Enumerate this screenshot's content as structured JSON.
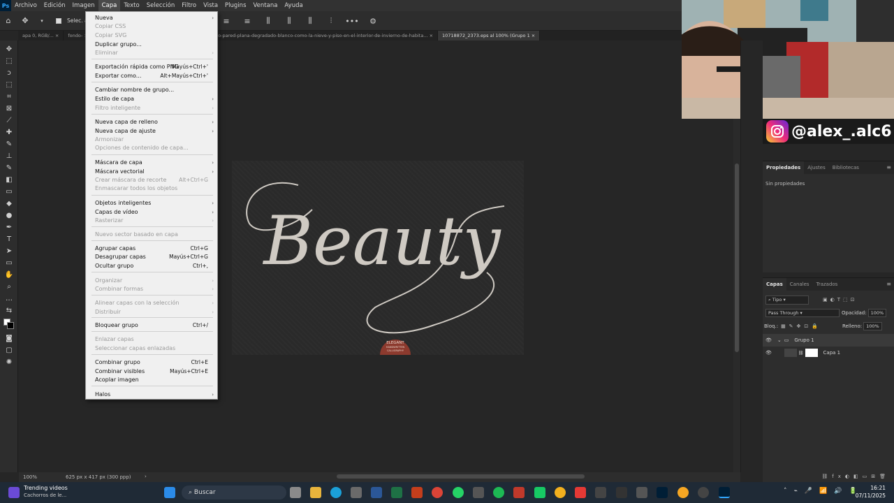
{
  "menubar": {
    "items": [
      "Archivo",
      "Edición",
      "Imagen",
      "Capa",
      "Texto",
      "Selección",
      "Filtro",
      "Vista",
      "Plugins",
      "Ventana",
      "Ayuda"
    ],
    "active_index": 3,
    "app_badge": "Ps"
  },
  "options_bar": {
    "autoselect_label": "Selec. autom"
  },
  "tabs": [
    {
      "label": "apa 0, RGB/...",
      "active": false
    },
    {
      "label": "fondo-",
      "active": false
    },
    {
      "label": "-de-fondo-de-belleza-azul-claro-oscuro-y-claro-gris-frio-pared-plana-degradado-blanco-como-la-nieve-y-piso-en-el-interior-de-invierno-de-habita...",
      "active": false
    },
    {
      "label": "10718872_2373.eps al 100% (Grupo 1",
      "active": true
    }
  ],
  "capa_menu": {
    "items": [
      {
        "label": "Nueva",
        "shortcut": "",
        "submenu": true,
        "disabled": false
      },
      {
        "label": "Copiar CSS",
        "shortcut": "",
        "submenu": false,
        "disabled": true
      },
      {
        "label": "Copiar SVG",
        "shortcut": "",
        "submenu": false,
        "disabled": true
      },
      {
        "label": "Duplicar grupo...",
        "shortcut": "",
        "submenu": false,
        "disabled": false
      },
      {
        "label": "Eliminar",
        "shortcut": "",
        "submenu": true,
        "disabled": true
      },
      {
        "label": "Exportación rápida como PNG",
        "shortcut": "Mayús+Ctrl+'",
        "submenu": false,
        "disabled": false
      },
      {
        "label": "Exportar como...",
        "shortcut": "Alt+Mayús+Ctrl+'",
        "submenu": false,
        "disabled": false
      },
      {
        "label": "Cambiar nombre de grupo...",
        "shortcut": "",
        "submenu": false,
        "disabled": false
      },
      {
        "label": "Estilo de capa",
        "shortcut": "",
        "submenu": true,
        "disabled": false
      },
      {
        "label": "Filtro inteligente",
        "shortcut": "",
        "submenu": true,
        "disabled": true
      },
      {
        "label": "Nueva capa de relleno",
        "shortcut": "",
        "submenu": true,
        "disabled": false
      },
      {
        "label": "Nueva capa de ajuste",
        "shortcut": "",
        "submenu": true,
        "disabled": false
      },
      {
        "label": "Armonizar",
        "shortcut": "",
        "submenu": false,
        "disabled": true
      },
      {
        "label": "Opciones de contenido de capa...",
        "shortcut": "",
        "submenu": false,
        "disabled": true
      },
      {
        "label": "Máscara de capa",
        "shortcut": "",
        "submenu": true,
        "disabled": false
      },
      {
        "label": "Máscara vectorial",
        "shortcut": "",
        "submenu": true,
        "disabled": false
      },
      {
        "label": "Crear máscara de recorte",
        "shortcut": "Alt+Ctrl+G",
        "submenu": false,
        "disabled": true
      },
      {
        "label": "Enmascarar todos los objetos",
        "shortcut": "",
        "submenu": false,
        "disabled": true
      },
      {
        "label": "Objetos inteligentes",
        "shortcut": "",
        "submenu": true,
        "disabled": false
      },
      {
        "label": "Capas de vídeo",
        "shortcut": "",
        "submenu": true,
        "disabled": false
      },
      {
        "label": "Rasterizar",
        "shortcut": "",
        "submenu": true,
        "disabled": true
      },
      {
        "label": "Nuevo sector basado en capa",
        "shortcut": "",
        "submenu": false,
        "disabled": true
      },
      {
        "label": "Agrupar capas",
        "shortcut": "Ctrl+G",
        "submenu": false,
        "disabled": false
      },
      {
        "label": "Desagrupar capas",
        "shortcut": "Mayús+Ctrl+G",
        "submenu": false,
        "disabled": false
      },
      {
        "label": "Ocultar grupo",
        "shortcut": "Ctrl+,",
        "submenu": false,
        "disabled": false
      },
      {
        "label": "Organizar",
        "shortcut": "",
        "submenu": true,
        "disabled": true
      },
      {
        "label": "Combinar formas",
        "shortcut": "",
        "submenu": true,
        "disabled": true
      },
      {
        "label": "Alinear capas con la selección",
        "shortcut": "",
        "submenu": true,
        "disabled": true
      },
      {
        "label": "Distribuir",
        "shortcut": "",
        "submenu": true,
        "disabled": true
      },
      {
        "label": "Bloquear grupo",
        "shortcut": "Ctrl+/",
        "submenu": false,
        "disabled": false
      },
      {
        "label": "Enlazar capas",
        "shortcut": "",
        "submenu": false,
        "disabled": true
      },
      {
        "label": "Seleccionar capas enlazadas",
        "shortcut": "",
        "submenu": false,
        "disabled": true
      },
      {
        "label": "Combinar grupo",
        "shortcut": "Ctrl+E",
        "submenu": false,
        "disabled": false
      },
      {
        "label": "Combinar visibles",
        "shortcut": "Mayús+Ctrl+E",
        "submenu": false,
        "disabled": false
      },
      {
        "label": "Acoplar imagen",
        "shortcut": "",
        "submenu": false,
        "disabled": false
      },
      {
        "label": "Halos",
        "shortcut": "",
        "submenu": true,
        "disabled": false
      }
    ]
  },
  "artwork": {
    "script_text": "Beauty",
    "badge_line1": "ELEGANT",
    "badge_line2": "HANDWRITTEN",
    "badge_line3": "CALLIGRAPHY",
    "badge_color": "#8c3a2e"
  },
  "statusbar": {
    "zoom": "100%",
    "doc_info": "625 px x 417 px (300 ppp)"
  },
  "social": {
    "handle": "@alex_.alc6"
  },
  "properties_panel": {
    "tabs": [
      "Propiedades",
      "Ajustes",
      "Bibliotecas"
    ],
    "empty_text": "Sin propiedades"
  },
  "layers_panel": {
    "tabs": [
      "Capas",
      "Canales",
      "Trazados"
    ],
    "filter_label": "Tipo",
    "blend_mode": "Pass Through",
    "opacity_label": "Opacidad:",
    "opacity_value": "100%",
    "lock_label": "Bloq.:",
    "fill_label": "Relleno:",
    "fill_value": "100%",
    "layers": [
      {
        "name": "Grupo 1",
        "type": "group"
      },
      {
        "name": "Capa 1",
        "type": "layer"
      }
    ]
  },
  "taskbar": {
    "news_title": "Trending videos",
    "news_sub": "Cachorros de le...",
    "search_placeholder": "Buscar",
    "time": "16:21",
    "date": "07/11/2025"
  }
}
